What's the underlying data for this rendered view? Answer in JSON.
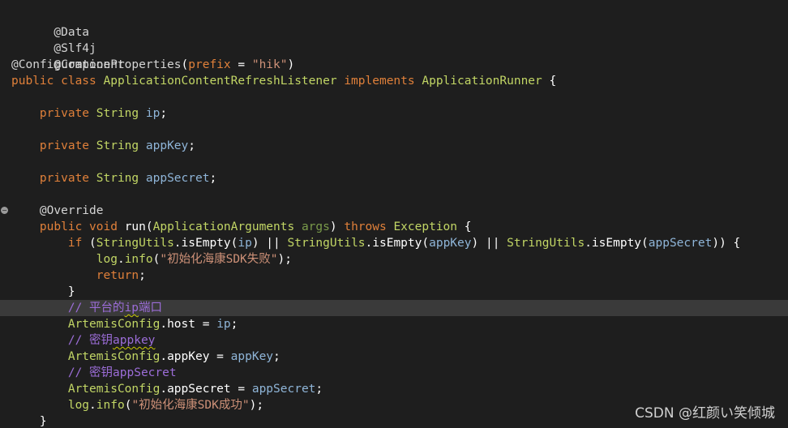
{
  "editor": {
    "fold_glyph": "−",
    "watermark": "CSDN @红颜い笑倾城"
  },
  "lines": [
    "@Data",
    "@Slf4j",
    "@Component",
    "@ConfigurationProperties(prefix = \"hik\")",
    "public class ApplicationContentRefreshListener implements ApplicationRunner {",
    "",
    "    private String ip;",
    "",
    "    private String appKey;",
    "",
    "    private String appSecret;",
    "",
    "    @Override",
    "    public void run(ApplicationArguments args) throws Exception {",
    "        if (StringUtils.isEmpty(ip) || StringUtils.isEmpty(appKey) || StringUtils.isEmpty(appSecret)) {",
    "            log.info(\"初始化海康SDK失败\");",
    "            return;",
    "        }",
    "        // 平台的ip端口",
    "        ArtemisConfig.host = ip;",
    "        // 密钥appkey",
    "        ArtemisConfig.appKey = appKey;",
    "        // 密钥appSecret",
    "        ArtemisConfig.appSecret = appSecret;",
    "        log.info(\"初始化海康SDK成功\");",
    "    }"
  ]
}
